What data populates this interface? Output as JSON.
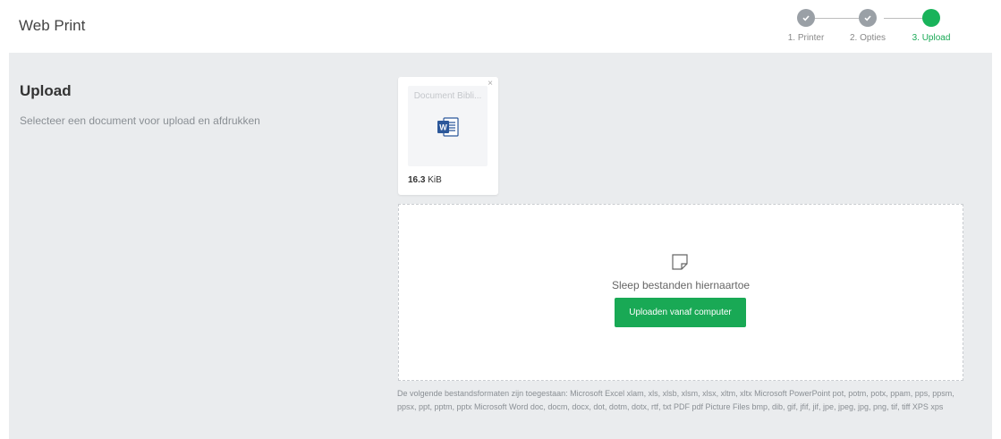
{
  "header": {
    "title": "Web Print"
  },
  "stepper": {
    "steps": [
      {
        "label": "1. Printer",
        "state": "done"
      },
      {
        "label": "2. Opties",
        "state": "done"
      },
      {
        "label": "3. Upload",
        "state": "active"
      }
    ],
    "colors": {
      "done": "#9aa0a6",
      "active": "#19b35a"
    }
  },
  "main": {
    "title": "Upload",
    "description": "Selecteer een document voor upload en afdrukken"
  },
  "file": {
    "name": "Document Bibli...",
    "icon": "word-document-icon",
    "size_value": "16.3",
    "size_unit": "KiB",
    "close_label": "×"
  },
  "dropzone": {
    "icon": "file-icon",
    "text": "Sleep bestanden hiernaartoe",
    "button_label": "Uploaden vanaf computer"
  },
  "formats_text": "De volgende bestandsformaten zijn toegestaan: Microsoft Excel xlam, xls, xlsb, xlsm, xlsx, xltm, xltx Microsoft PowerPoint pot, potm, potx, ppam, pps, ppsm, ppsx, ppt, pptm, pptx Microsoft Word doc, docm, docx, dot, dotm, dotx, rtf, txt PDF pdf Picture Files bmp, dib, gif, jfif, jif, jpe, jpeg, jpg, png, tif, tiff XPS xps",
  "accent_color": "#19a955"
}
